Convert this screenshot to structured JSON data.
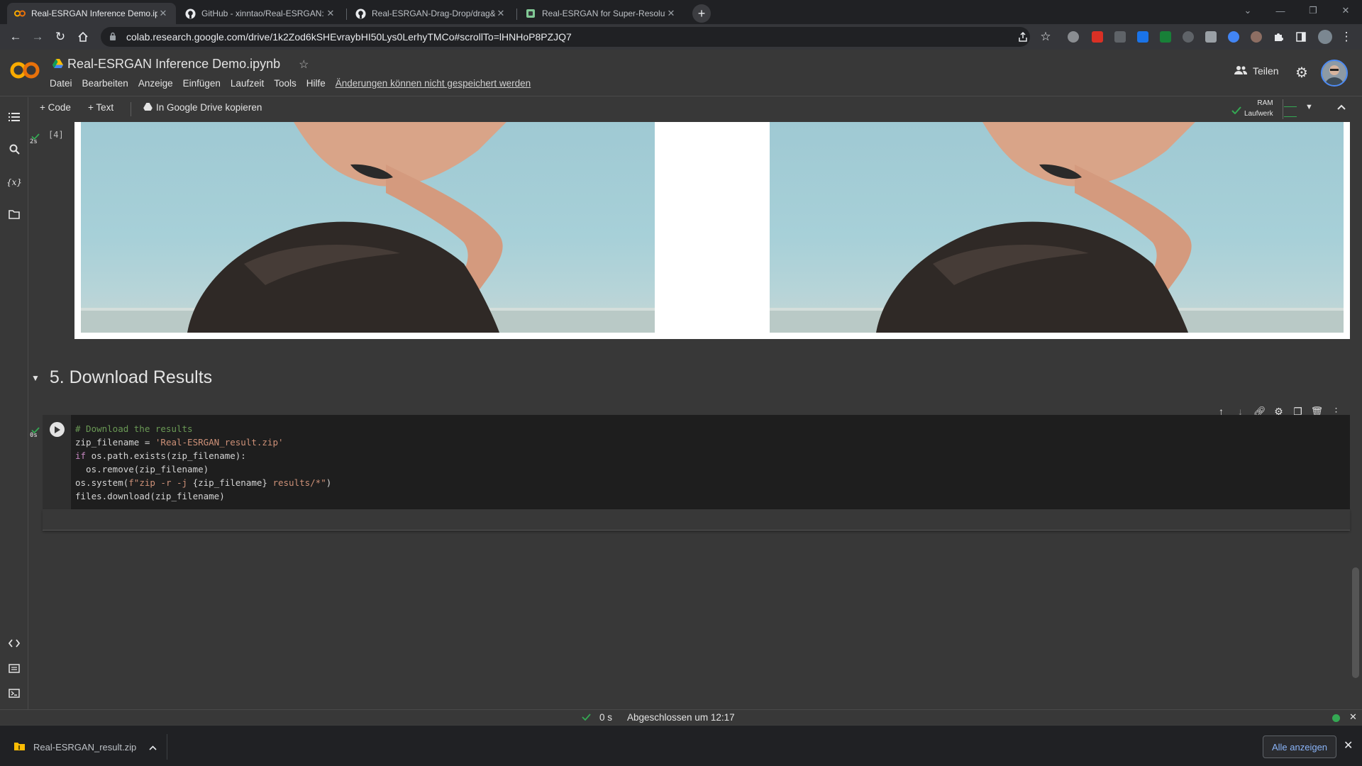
{
  "browser": {
    "tabs": [
      {
        "title": "Real-ESRGAN Inference Demo.ip"
      },
      {
        "title": "GitHub - xinntao/Real-ESRGAN: I"
      },
      {
        "title": "Real-ESRGAN-Drag-Drop/drag&"
      },
      {
        "title": "Real-ESRGAN for Super-Resoluti"
      }
    ],
    "url": "colab.research.google.com/drive/1k2Zod6kSHEvraybHI50Lys0LerhyTMCo#scrollTo=lHNHoP8PZJQ7",
    "colors": {
      "tab_strip": "#202124",
      "toolbar": "#35363a"
    }
  },
  "colab": {
    "notebook_title": "Real-ESRGAN Inference Demo.ipynb",
    "menu": [
      "Datei",
      "Bearbeiten",
      "Anzeige",
      "Einfügen",
      "Laufzeit",
      "Tools",
      "Hilfe"
    ],
    "unsaved_notice": "Änderungen können nicht gespeichert werden",
    "share_label": "Teilen",
    "toolbar": {
      "add_code": "+ Code",
      "add_text": "+ Text",
      "copy_drive": "In Google Drive kopieren"
    },
    "resources": {
      "ram": "RAM",
      "disk": "Laufwerk"
    }
  },
  "notebook": {
    "output_cell": {
      "exec_label": "[4]",
      "duration": "2s"
    },
    "section_title": "5. Download Results",
    "code_cell": {
      "duration": "0s",
      "line1": "# Download the results",
      "line2_var": "zip_filename = ",
      "line2_str": "'Real-ESRGAN_result.zip'",
      "line3_kw": "if",
      "line3_rest": " os.path.exists(zip_filename):",
      "line4": "  os.remove(zip_filename)",
      "line5_a": "os.system(",
      "line5_b": "f\"zip -r -j ",
      "line5_c": "{zip_filename}",
      "line5_d": " results/*\"",
      "line5_e": ")",
      "line6": "files.download(zip_filename)"
    }
  },
  "statusbar": {
    "duration": "0 s",
    "text": "Abgeschlossen um 12:17"
  },
  "download": {
    "file_name": "Real-ESRGAN_result.zip",
    "show_all": "Alle anzeigen"
  }
}
